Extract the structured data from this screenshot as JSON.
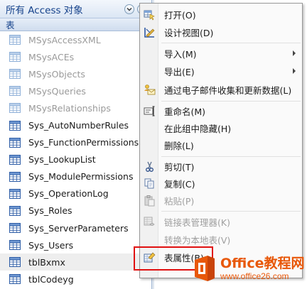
{
  "nav": {
    "title": "所有 Access 对象",
    "group": "表",
    "items": [
      {
        "label": "MSysAccessXML",
        "system": true
      },
      {
        "label": "MSysACEs",
        "system": true
      },
      {
        "label": "MSysObjects",
        "system": true
      },
      {
        "label": "MSysQueries",
        "system": true
      },
      {
        "label": "MSysRelationships",
        "system": true
      },
      {
        "label": "Sys_AutoNumberRules",
        "system": false
      },
      {
        "label": "Sys_FunctionPermissions",
        "system": false
      },
      {
        "label": "Sys_LookupList",
        "system": false
      },
      {
        "label": "Sys_ModulePermissions",
        "system": false
      },
      {
        "label": "Sys_OperationLog",
        "system": false
      },
      {
        "label": "Sys_Roles",
        "system": false
      },
      {
        "label": "Sys_ServerParameters",
        "system": false
      },
      {
        "label": "Sys_Users",
        "system": false
      },
      {
        "label": "tblBxmx",
        "system": false,
        "selected": true
      },
      {
        "label": "tblCodeyg",
        "system": false
      }
    ]
  },
  "menu": {
    "open": "打开(O)",
    "design_view": "设计视图(D)",
    "import": "导入(M)",
    "export": "导出(E)",
    "collect_email": "通过电子邮件收集和更新数据(L)",
    "rename": "重命名(M)",
    "hide_in_group": "在此组中隐藏(H)",
    "delete": "删除(L)",
    "cut": "剪切(T)",
    "copy": "复制(C)",
    "paste": "粘贴(P)",
    "linked_table_manager": "链接表管理器(K)",
    "convert_to_local": "转换为本地表(V)",
    "table_properties": "表属性(B)"
  },
  "watermark": {
    "title": "Office教程网",
    "url": "www.office26.com"
  },
  "colors": {
    "nav_header_text": "#15428b",
    "highlight_border": "#e01010",
    "watermark": "#e8580a"
  }
}
